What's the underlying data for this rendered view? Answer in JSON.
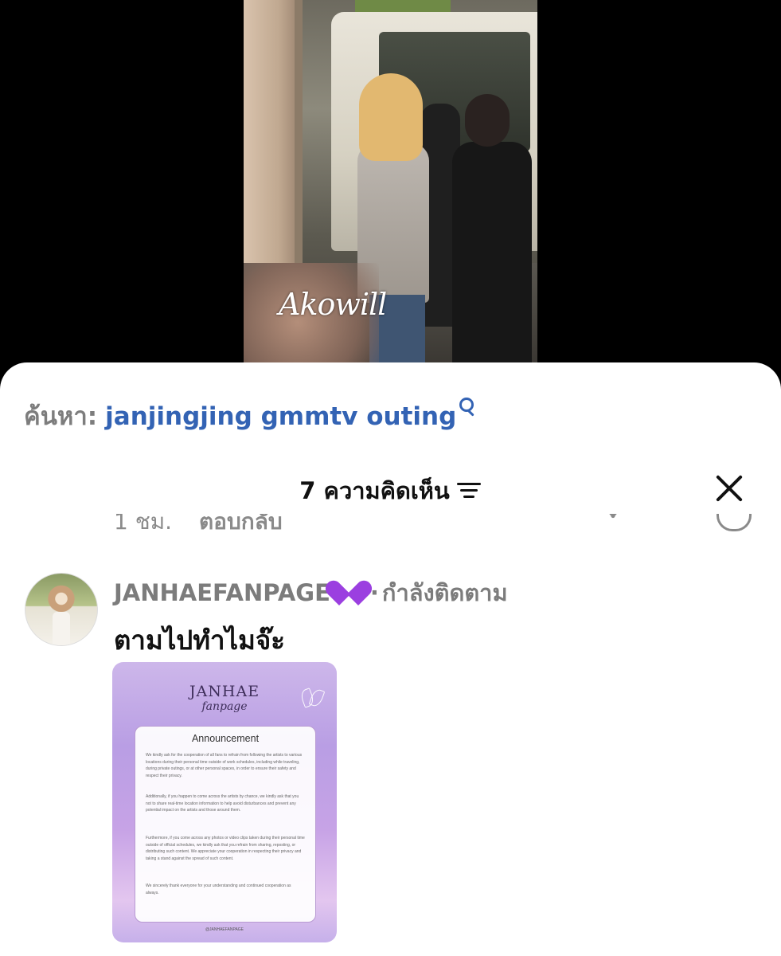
{
  "video": {
    "watermark": "Akowill"
  },
  "search": {
    "prefix": "ค้นหา:",
    "query": "janjingjing gmmtv outing",
    "icon": "search-icon"
  },
  "comments_header": {
    "title": "7 ความคิดเห็น",
    "sort_icon": "sort-icon",
    "close_icon": "close-icon"
  },
  "previous_comment": {
    "time": "1 ชม.",
    "reply_label": "ตอบกลับ"
  },
  "comment": {
    "username": "JANHAEFANPAGE",
    "badge_icon": "purple-heart-icon",
    "separator": "·",
    "follow_status": "กำลังติดตาม",
    "text": "ตามไปทำไมจ๊ะ",
    "attachment": {
      "logo_main": "JANHAE",
      "logo_sub": "fanpage",
      "card_title": "Announcement",
      "paragraphs": [
        "We kindly ask for the cooperation of all fans to refrain from following the artists to various locations during their personal time outside of work schedules, including while traveling, during private outings, or at other personal spaces, in order to ensure their safety and respect their privacy.",
        "Additionally, if you happen to come across the artists by chance, we kindly ask that you not to share real-time location information to help avoid disturbances and prevent any potential impact on the artists and those around them.",
        "Furthermore, if you come across any photos or video clips taken during their personal time outside of official schedules, we kindly ask that you refrain from sharing, reposting, or distributing such content. We appreciate your cooperation in respecting their privacy and taking a stand against the spread of such content.",
        "We sincerely thank everyone for your understanding and continued cooperation as always."
      ],
      "footer": "@JANHAEFANPAGE"
    }
  },
  "colors": {
    "search_query": "#3363b4",
    "badge": "#9b3fe0",
    "muted_text": "#7c7c7c"
  }
}
